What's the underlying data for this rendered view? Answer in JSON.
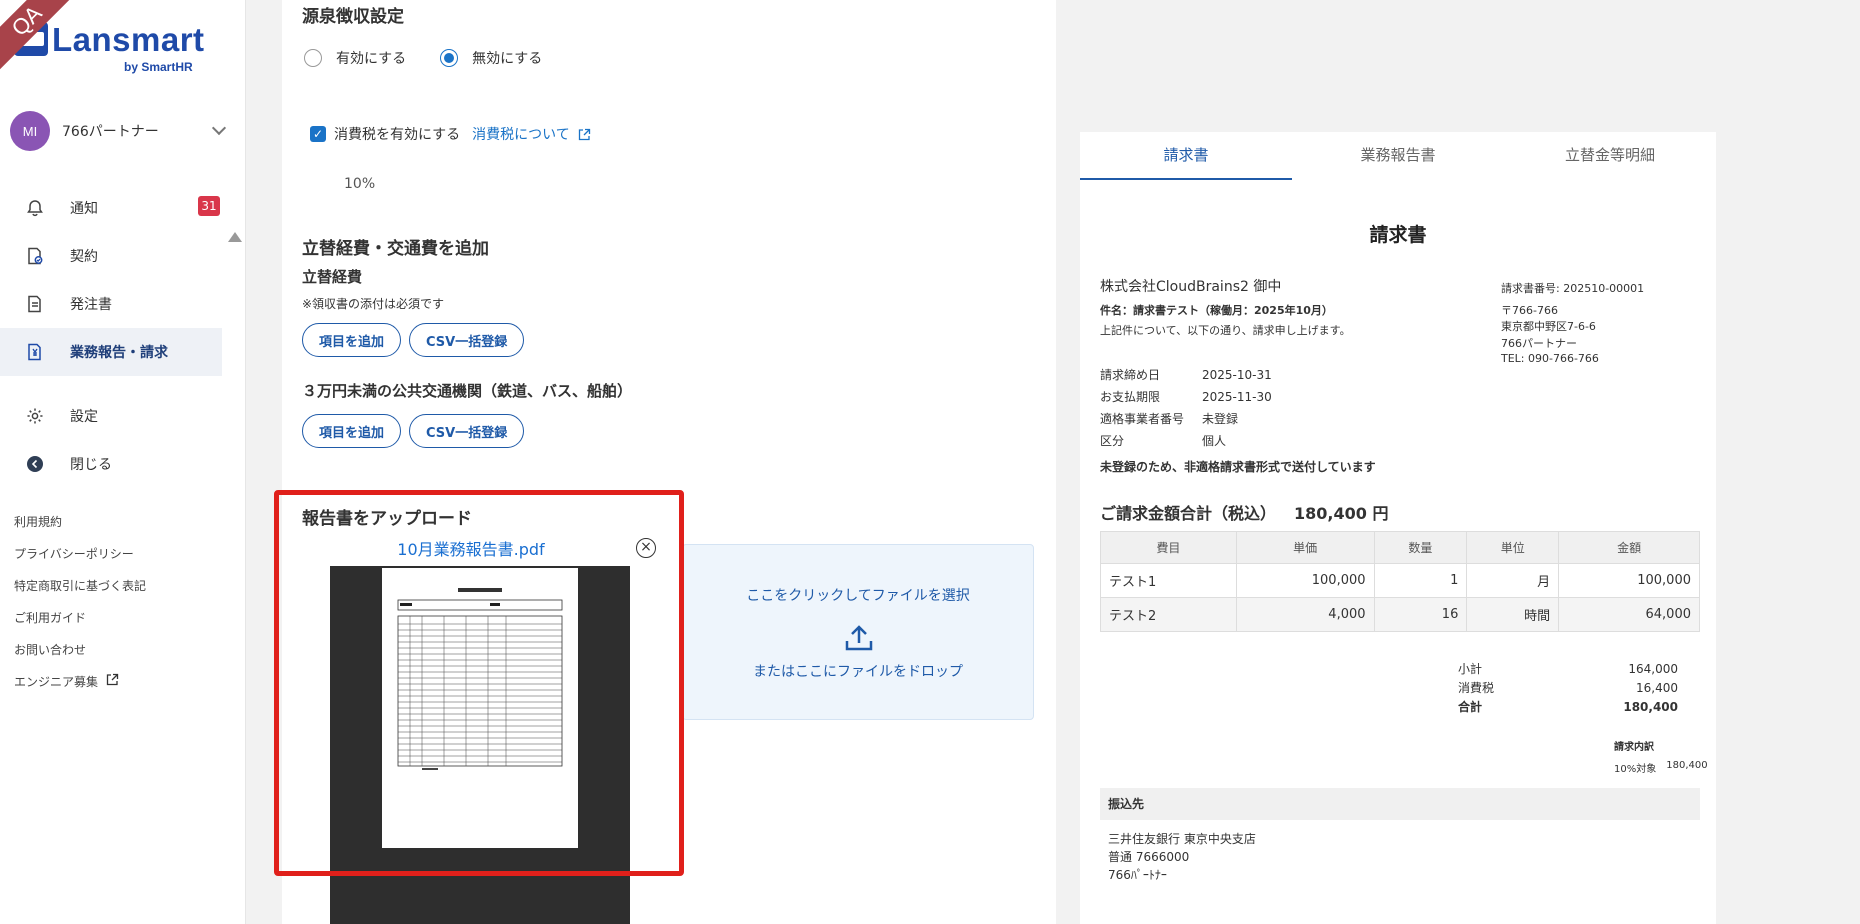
{
  "ribbon": "QA",
  "brand": {
    "name": "Lansmart",
    "sub": "by SmartHR"
  },
  "user": {
    "initials": "MI",
    "name": "766パートナー"
  },
  "nav": [
    {
      "label": "通知",
      "icon": "bell-icon",
      "badge": "31"
    },
    {
      "label": "契約",
      "icon": "contract-icon"
    },
    {
      "label": "発注書",
      "icon": "document-icon"
    },
    {
      "label": "業務報告・請求",
      "icon": "invoice-icon"
    },
    {
      "label": "設定",
      "icon": "gear-icon"
    },
    {
      "label": "閉じる",
      "icon": "close-sidebar-icon"
    }
  ],
  "footer_links": [
    "利用規約",
    "プライバシーポリシー",
    "特定商取引に基づく表記",
    "ご利用ガイド",
    "お問い合わせ",
    "エンジニア募集"
  ],
  "withholding": {
    "title": "源泉徴収設定",
    "opt_enable": "有効にする",
    "opt_disable": "無効にする",
    "selected": "無効にする"
  },
  "tax": {
    "label": "消費税を有効にする",
    "link": "消費税について",
    "rate": "10%"
  },
  "expenses": {
    "title": "立替経費・交通費を追加",
    "sub": "立替経費",
    "note": "※領収書の添付は必須です",
    "add": "項目を追加",
    "csv": "CSV一括登録",
    "transit_title": "３万円未満の公共交通機関（鉄道、バス、船舶）"
  },
  "upload": {
    "title": "報告書をアップロード",
    "file_name": "10月業務報告書.pdf",
    "click_text": "ここをクリックしてファイルを選択",
    "drop_text": "またはここにファイルをドロップ"
  },
  "tabs": [
    "請求書",
    "業務報告書",
    "立替金等明細"
  ],
  "invoice": {
    "title": "請求書",
    "client": "株式会社CloudBrains2 御中",
    "subject": "件名：請求書テスト（稼働月：2025年10月）",
    "intro": "上記件について、以下の通り、請求申し上げます。",
    "invoice_no": "請求書番号: 202510-00001",
    "address": [
      "〒766-766",
      "東京都中野区7-6-6",
      "766パートナー",
      "TEL: 090-766-766"
    ],
    "meta": [
      {
        "k": "請求締め日",
        "v": "2025-10-31"
      },
      {
        "k": "お支払期限",
        "v": "2025-11-30"
      },
      {
        "k": "適格事業者番号",
        "v": "未登録"
      },
      {
        "k": "区分",
        "v": "個人"
      }
    ],
    "notice": "未登録のため、非適格請求書形式で送付しています",
    "total_label": "ご請求金額合計（税込）",
    "total_value": "180,400 円",
    "columns": [
      "費目",
      "単価",
      "数量",
      "単位",
      "金額"
    ],
    "rows": [
      [
        "テスト1",
        "100,000",
        "1",
        "月",
        "100,000"
      ],
      [
        "テスト2",
        "4,000",
        "16",
        "時間",
        "64,000"
      ]
    ],
    "summary": [
      {
        "k": "小計",
        "v": "164,000"
      },
      {
        "k": "消費税",
        "v": "16,400"
      },
      {
        "k": "合計",
        "v": "180,400"
      }
    ],
    "breakdown_title": "請求内訳",
    "breakdown_k": "10%対象",
    "breakdown_v": "180,400",
    "bank_title": "振込先",
    "bank": [
      "三井住友銀行 東京中央支店",
      "普通 7666000",
      "766ﾊﾟｰﾄﾅｰ"
    ]
  }
}
